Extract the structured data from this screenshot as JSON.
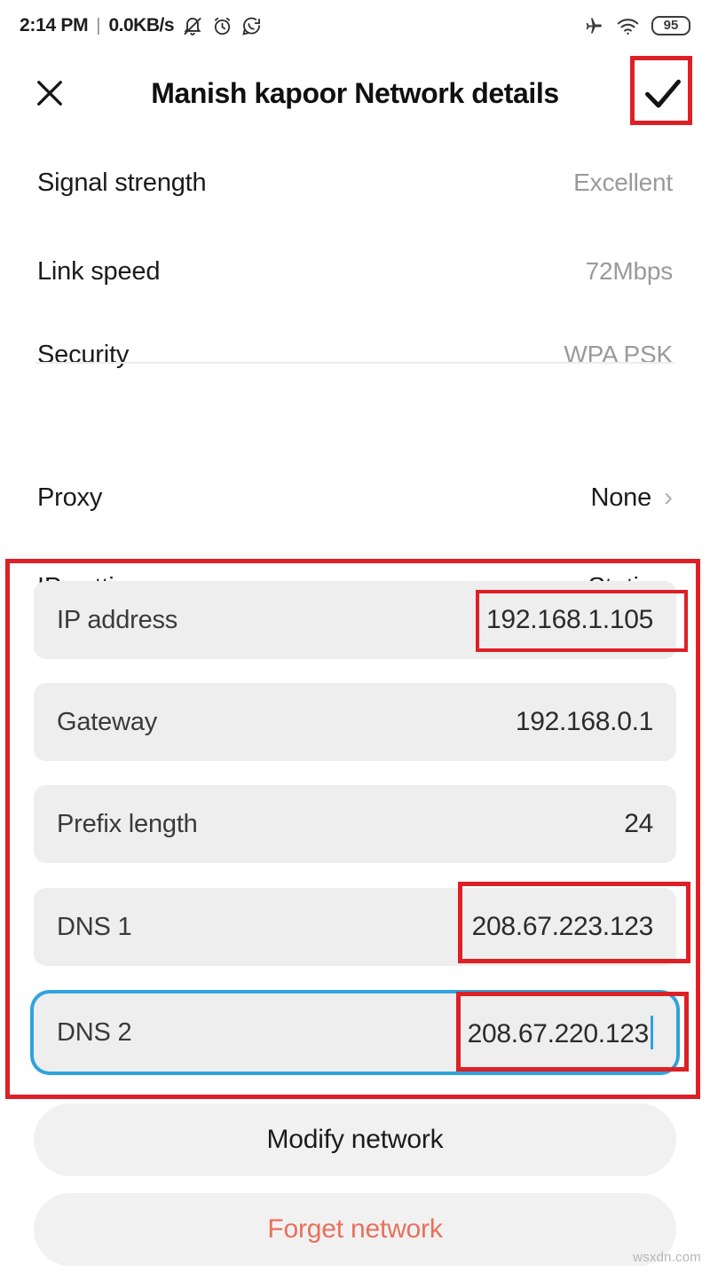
{
  "statusbar": {
    "time": "2:14 PM",
    "separator": "|",
    "network_speed": "0.0KB/s",
    "left_icons": [
      "bell-muted-icon",
      "alarm-clock-icon",
      "whatsapp-icon"
    ],
    "right_icons": [
      "airplane-mode-icon",
      "wifi-icon"
    ],
    "battery_level": "95"
  },
  "header": {
    "close_label": "✕",
    "title": "Manish kapoor Network details",
    "confirm_label": "✓"
  },
  "info_rows": [
    {
      "label": "Signal strength",
      "value": "Excellent"
    },
    {
      "label": "Link speed",
      "value": "72Mbps"
    },
    {
      "label": "Security",
      "value": "WPA PSK"
    }
  ],
  "setting_rows": [
    {
      "label": "Proxy",
      "value": "None",
      "chevron": "›"
    },
    {
      "label": "IP settings",
      "value": "Static",
      "chevron": "›"
    }
  ],
  "fields": [
    {
      "label": "IP address",
      "value": "192.168.1.105",
      "focused": false
    },
    {
      "label": "Gateway",
      "value": "192.168.0.1",
      "focused": false
    },
    {
      "label": "Prefix length",
      "value": "24",
      "focused": false
    },
    {
      "label": "DNS 1",
      "value": "208.67.223.123",
      "focused": false
    },
    {
      "label": "DNS 2",
      "value": "208.67.220.123",
      "focused": true
    }
  ],
  "actions": [
    {
      "label": "Modify network",
      "style": "primary"
    },
    {
      "label": "Forget network",
      "style": "danger"
    }
  ],
  "watermark": "wsxdn.com",
  "colors": {
    "annotation_red": "#dd2026",
    "focus_blue": "#2fa3dd",
    "field_gray": "#eeeeee",
    "danger_text": "#e8705a"
  }
}
